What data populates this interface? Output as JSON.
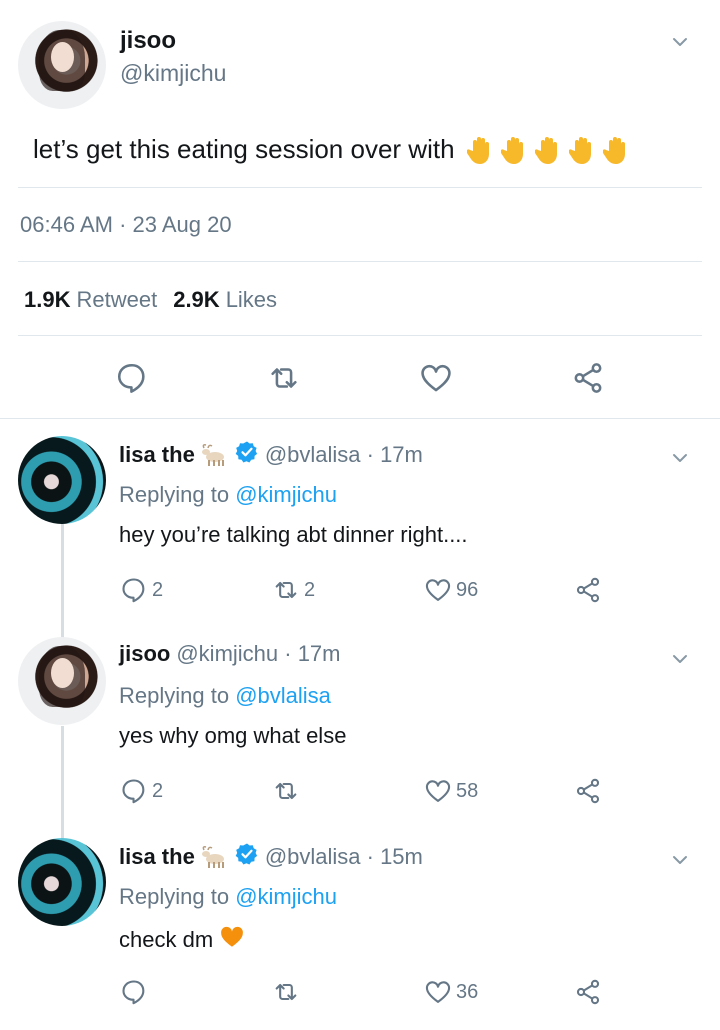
{
  "main_tweet": {
    "author_name": "jisoo",
    "author_handle": "@kimjichu",
    "text": "let’s get this eating session over with",
    "emoji": "✋✋✋✋✋",
    "timestamp": "06:46 AM · 23 Aug 20",
    "retweets_count": "1.9K",
    "retweets_label": "Retweet",
    "likes_count": "2.9K",
    "likes_label": "Likes"
  },
  "replies": [
    {
      "name": "lisa the",
      "name_emoji": "goat",
      "verified": true,
      "handle_time": "@bvlalisa · 17m",
      "replying_prefix": "Replying to",
      "replying_to": "@kimjichu",
      "text": "hey you’re talking abt dinner right....",
      "reply_count": "2",
      "retweet_count": "2",
      "like_count": "96"
    },
    {
      "name": "jisoo",
      "verified": false,
      "handle_time": "@kimjichu · 17m",
      "replying_prefix": "Replying to",
      "replying_to": "@bvlalisa",
      "text": "yes why omg what else",
      "reply_count": "2",
      "retweet_count": "",
      "like_count": "58"
    },
    {
      "name": "lisa the",
      "name_emoji": "goat",
      "verified": true,
      "handle_time": "@bvlalisa · 15m",
      "replying_prefix": "Replying to",
      "replying_to": "@kimjichu",
      "text": "check dm",
      "text_emoji": "orange-heart",
      "reply_count": "",
      "retweet_count": "",
      "like_count": "36"
    }
  ],
  "colors": {
    "accent": "#1da1f2",
    "muted": "#657786",
    "text": "#14171a",
    "divider": "#e1e8ed",
    "emoji_yellow": "#f7b82a",
    "orange_heart": "#f4900c"
  },
  "icons": [
    "chevron-down-icon",
    "reply-icon",
    "retweet-icon",
    "like-icon",
    "share-icon",
    "verified-icon",
    "goat-emoji-icon",
    "raised-hand-emoji-icon",
    "orange-heart-emoji-icon"
  ]
}
